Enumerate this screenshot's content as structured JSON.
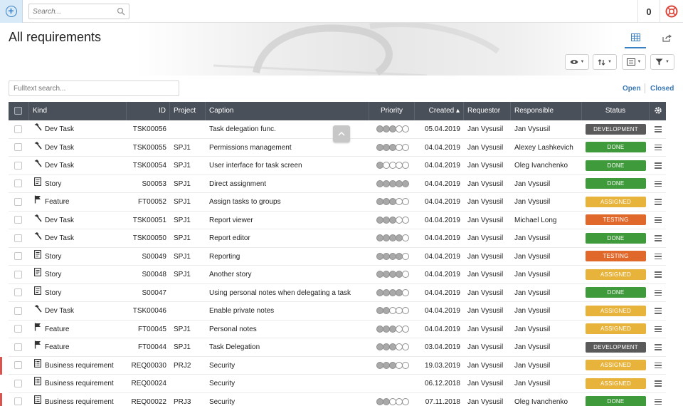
{
  "topbar": {
    "search_placeholder": "Search...",
    "counter": "0"
  },
  "page": {
    "title": "All requirements",
    "fulltext_placeholder": "Fulltext search...",
    "link_open": "Open",
    "link_closed": "Closed"
  },
  "colors": {
    "header_bg": "#4a505a",
    "development": "#5a5a5a",
    "done": "#3e9a3a",
    "assigned": "#e8b33a",
    "testing": "#e0682b",
    "accent": "#3a7fc1"
  },
  "columns": {
    "kind": "Kind",
    "id": "ID",
    "project": "Project",
    "caption": "Caption",
    "priority": "Priority",
    "created": "Created ▴",
    "requestor": "Requestor",
    "responsible": "Responsible",
    "status": "Status"
  },
  "rows": [
    {
      "kind": "Dev Task",
      "icon": "hammer-icon",
      "id": "TSK00056",
      "project": "",
      "caption": "Task delegation func.",
      "priority": 3,
      "created": "05.04.2019",
      "requestor": "Jan Vysusil",
      "responsible": "Jan Vysusil",
      "status": "DEVELOPMENT",
      "status_key": "development",
      "marked": false
    },
    {
      "kind": "Dev Task",
      "icon": "hammer-icon",
      "id": "TSK00055",
      "project": "SPJ1",
      "caption": "Permissions management",
      "priority": 3,
      "created": "04.04.2019",
      "requestor": "Jan Vysusil",
      "responsible": "Alexey Lashkevich",
      "status": "DONE",
      "status_key": "done",
      "marked": false
    },
    {
      "kind": "Dev Task",
      "icon": "hammer-icon",
      "id": "TSK00054",
      "project": "SPJ1",
      "caption": "User interface for task screen",
      "priority": 1,
      "created": "04.04.2019",
      "requestor": "Jan Vysusil",
      "responsible": "Oleg Ivanchenko",
      "status": "DONE",
      "status_key": "done",
      "marked": false
    },
    {
      "kind": "Story",
      "icon": "document-icon",
      "id": "S00053",
      "project": "SPJ1",
      "caption": "Direct assignment",
      "priority": 5,
      "created": "04.04.2019",
      "requestor": "Jan Vysusil",
      "responsible": "Jan Vysusil",
      "status": "DONE",
      "status_key": "done",
      "marked": false
    },
    {
      "kind": "Feature",
      "icon": "flag-icon",
      "id": "FT00052",
      "project": "SPJ1",
      "caption": "Assign tasks to groups",
      "priority": 3,
      "created": "04.04.2019",
      "requestor": "Jan Vysusil",
      "responsible": "Jan Vysusil",
      "status": "ASSIGNED",
      "status_key": "assigned",
      "marked": false
    },
    {
      "kind": "Dev Task",
      "icon": "hammer-icon",
      "id": "TSK00051",
      "project": "SPJ1",
      "caption": "Report viewer",
      "priority": 3,
      "created": "04.04.2019",
      "requestor": "Jan Vysusil",
      "responsible": "Michael Long",
      "status": "TESTING",
      "status_key": "testing",
      "marked": false
    },
    {
      "kind": "Dev Task",
      "icon": "hammer-icon",
      "id": "TSK00050",
      "project": "SPJ1",
      "caption": "Report editor",
      "priority": 4,
      "created": "04.04.2019",
      "requestor": "Jan Vysusil",
      "responsible": "Jan Vysusil",
      "status": "DONE",
      "status_key": "done",
      "marked": false
    },
    {
      "kind": "Story",
      "icon": "document-icon",
      "id": "S00049",
      "project": "SPJ1",
      "caption": "Reporting",
      "priority": 4,
      "created": "04.04.2019",
      "requestor": "Jan Vysusil",
      "responsible": "Jan Vysusil",
      "status": "TESTING",
      "status_key": "testing",
      "marked": false
    },
    {
      "kind": "Story",
      "icon": "document-icon",
      "id": "S00048",
      "project": "SPJ1",
      "caption": "Another story",
      "priority": 4,
      "created": "04.04.2019",
      "requestor": "Jan Vysusil",
      "responsible": "Jan Vysusil",
      "status": "ASSIGNED",
      "status_key": "assigned",
      "marked": false
    },
    {
      "kind": "Story",
      "icon": "document-icon",
      "id": "S00047",
      "project": "",
      "caption": "Using personal notes when delegating a task",
      "priority": 4,
      "created": "04.04.2019",
      "requestor": "Jan Vysusil",
      "responsible": "Jan Vysusil",
      "status": "DONE",
      "status_key": "done",
      "marked": false
    },
    {
      "kind": "Dev Task",
      "icon": "hammer-icon",
      "id": "TSK00046",
      "project": "",
      "caption": "Enable private notes",
      "priority": 2,
      "created": "04.04.2019",
      "requestor": "Jan Vysusil",
      "responsible": "Jan Vysusil",
      "status": "ASSIGNED",
      "status_key": "assigned",
      "marked": false
    },
    {
      "kind": "Feature",
      "icon": "flag-icon",
      "id": "FT00045",
      "project": "SPJ1",
      "caption": "Personal notes",
      "priority": 3,
      "created": "04.04.2019",
      "requestor": "Jan Vysusil",
      "responsible": "Jan Vysusil",
      "status": "ASSIGNED",
      "status_key": "assigned",
      "marked": false
    },
    {
      "kind": "Feature",
      "icon": "flag-icon",
      "id": "FT00044",
      "project": "SPJ1",
      "caption": "Task Delegation",
      "priority": 3,
      "created": "03.04.2019",
      "requestor": "Jan Vysusil",
      "responsible": "Jan Vysusil",
      "status": "DEVELOPMENT",
      "status_key": "development",
      "marked": false
    },
    {
      "kind": "Business requirement",
      "icon": "checklist-icon",
      "id": "REQ00030",
      "project": "PRJ2",
      "caption": "Security",
      "priority": 3,
      "created": "19.03.2019",
      "requestor": "Jan Vysusil",
      "responsible": "Jan Vysusil",
      "status": "ASSIGNED",
      "status_key": "assigned",
      "marked": true
    },
    {
      "kind": "Business requirement",
      "icon": "checklist-icon",
      "id": "REQ00024",
      "project": "",
      "caption": "Security",
      "priority": 0,
      "created": "06.12.2018",
      "requestor": "Jan Vysusil",
      "responsible": "Jan Vysusil",
      "status": "ASSIGNED",
      "status_key": "assigned",
      "marked": false
    },
    {
      "kind": "Business requirement",
      "icon": "checklist-icon",
      "id": "REQ00022",
      "project": "PRJ3",
      "caption": "Security",
      "priority": 2,
      "created": "07.11.2018",
      "requestor": "Jan Vysusil",
      "responsible": "Oleg Ivanchenko",
      "status": "DONE",
      "status_key": "done",
      "marked": true
    }
  ]
}
